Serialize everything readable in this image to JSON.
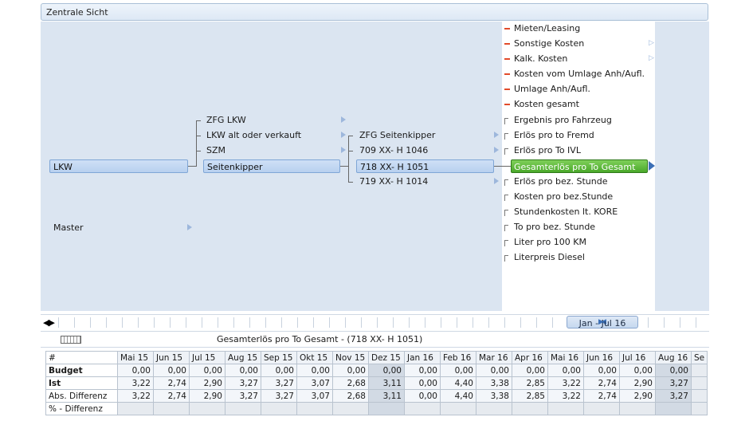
{
  "header": {
    "title": "Zentrale Sicht"
  },
  "tree": {
    "root": [
      {
        "label": "LKW",
        "selected": true
      },
      {
        "label": "Master",
        "selected": false
      }
    ],
    "level2": [
      {
        "label": "ZFG LKW"
      },
      {
        "label": "LKW alt oder verkauft"
      },
      {
        "label": "SZM"
      },
      {
        "label": "Seitenkipper",
        "selected": true
      }
    ],
    "level3": [
      {
        "label": "ZFG Seitenkipper"
      },
      {
        "label": "709 XX- H 1046"
      },
      {
        "label": "718 XX- H 1051",
        "selected": true
      },
      {
        "label": "719 XX- H 1014"
      }
    ]
  },
  "measures": [
    {
      "label": "Mieten/Leasing",
      "marker": "red"
    },
    {
      "label": "Sonstige Kosten",
      "marker": "red",
      "expandable": true
    },
    {
      "label": "Kalk. Kosten",
      "marker": "red",
      "expandable": true
    },
    {
      "label": "Kosten vom Umlage Anh/Aufl.",
      "marker": "redbracket"
    },
    {
      "label": "Umlage Anh/Aufl.",
      "marker": "red"
    },
    {
      "label": "Kosten gesamt",
      "marker": "redbracket"
    },
    {
      "label": "Ergebnis pro Fahrzeug",
      "marker": "gray"
    },
    {
      "label": "Erlös pro to Fremd",
      "marker": "gray"
    },
    {
      "label": "Erlös pro To IVL",
      "marker": "gray"
    },
    {
      "label": "Gesamterlös pro To Gesamt",
      "marker": "green",
      "selected": true
    },
    {
      "label": "Erlös pro bez. Stunde",
      "marker": "gray"
    },
    {
      "label": "Kosten pro bez.Stunde",
      "marker": "gray"
    },
    {
      "label": "Stundenkosten lt. KORE",
      "marker": "gray"
    },
    {
      "label": "To pro bez. Stunde",
      "marker": "gray"
    },
    {
      "label": "Liter pro 100 KM",
      "marker": "gray"
    },
    {
      "label": "Literpreis Diesel",
      "marker": "gray"
    }
  ],
  "timeline": {
    "range_label": "Jan - Jul 16",
    "nav_left": "◀▶"
  },
  "infobar": {
    "text": "Gesamterlös pro To Gesamt - (718 XX- H 1051)"
  },
  "table": {
    "columns": [
      "#",
      "Mai 15",
      "Jun 15",
      "Jul 15",
      "Aug 15",
      "Sep 15",
      "Okt 15",
      "Nov 15",
      "Dez 15",
      "Jan 16",
      "Feb 16",
      "Mar 16",
      "Apr 16",
      "Mai 16",
      "Jun 16",
      "Jul 16",
      "Aug 16",
      "Se"
    ],
    "rows": [
      {
        "label": "Budget",
        "bold": true,
        "values": [
          "0,00",
          "0,00",
          "0,00",
          "0,00",
          "0,00",
          "0,00",
          "0,00",
          "0,00",
          "0,00",
          "0,00",
          "0,00",
          "0,00",
          "0,00",
          "0,00",
          "0,00",
          "0,00",
          ""
        ]
      },
      {
        "label": "Ist",
        "bold": true,
        "values": [
          "3,22",
          "2,74",
          "2,90",
          "3,27",
          "3,27",
          "3,07",
          "2,68",
          "3,11",
          "0,00",
          "4,40",
          "3,38",
          "2,85",
          "3,22",
          "2,74",
          "2,90",
          "3,27",
          ""
        ]
      },
      {
        "label": "Abs. Differenz",
        "bold": false,
        "values": [
          "3,22",
          "2,74",
          "2,90",
          "3,27",
          "3,27",
          "3,07",
          "2,68",
          "3,11",
          "0,00",
          "4,40",
          "3,38",
          "2,85",
          "3,22",
          "2,74",
          "2,90",
          "3,27",
          ""
        ]
      },
      {
        "label": "% - Differenz",
        "bold": false,
        "values": [
          "",
          "",
          "",
          "",
          "",
          "",
          "",
          "",
          "",
          "",
          "",
          "",
          "",
          "",
          "",
          "",
          ""
        ]
      }
    ]
  },
  "colors": {
    "canvas_bg": "#dbe5f1",
    "selected_blue": "#b8d0ef",
    "selected_green": "#4aa82a",
    "marker_red": "#e24b2b"
  }
}
